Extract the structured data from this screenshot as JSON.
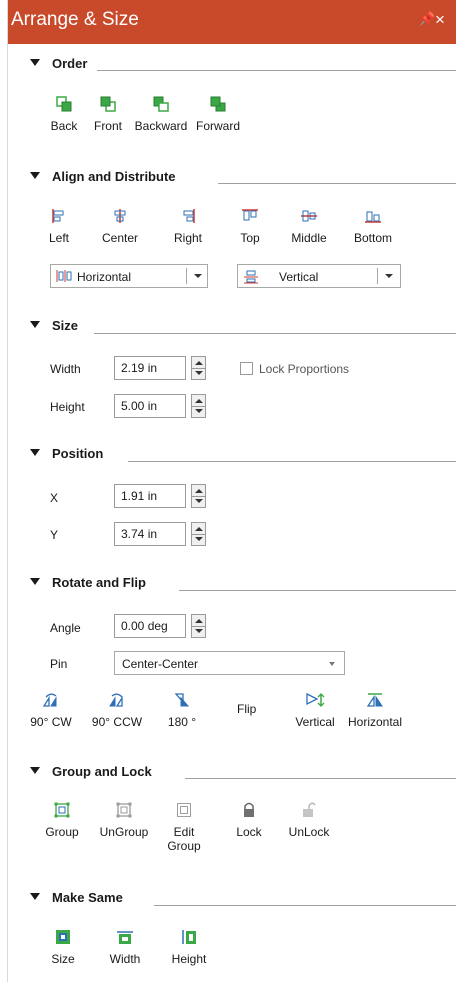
{
  "panel": {
    "title": "Arrange & Size",
    "pin_glyph": "\u0004",
    "close_glyph": "×",
    "accent": "#c94a2b",
    "green": "#3aa845",
    "blue": "#2f6fb6"
  },
  "order": {
    "header": "Order",
    "items": [
      {
        "label": "Back",
        "icon": "send-to-back-icon"
      },
      {
        "label": "Front",
        "icon": "bring-to-front-icon"
      },
      {
        "label": "Backward",
        "icon": "send-backward-icon"
      },
      {
        "label": "Forward",
        "icon": "bring-forward-icon"
      }
    ]
  },
  "align": {
    "header": "Align and Distribute",
    "items": [
      {
        "label": "Left",
        "icon": "align-left-icon"
      },
      {
        "label": "Center",
        "icon": "align-center-icon"
      },
      {
        "label": "Right",
        "icon": "align-right-icon"
      },
      {
        "label": "Top",
        "icon": "align-top-icon"
      },
      {
        "label": "Middle",
        "icon": "align-middle-icon"
      },
      {
        "label": "Bottom",
        "icon": "align-bottom-icon"
      }
    ],
    "distribute_horizontal": "Horizontal",
    "distribute_vertical": "Vertical"
  },
  "size": {
    "header": "Size",
    "width_label": "Width",
    "width_value": "2.19 in",
    "height_label": "Height",
    "height_value": "5.00 in",
    "lock_label": "Lock Proportions",
    "lock_checked": false
  },
  "position": {
    "header": "Position",
    "x_label": "X",
    "x_value": "1.91 in",
    "y_label": "Y",
    "y_value": "3.74 in"
  },
  "rotate": {
    "header": "Rotate and Flip",
    "angle_label": "Angle",
    "angle_value": "0.00 deg",
    "pin_label": "Pin",
    "pin_value": "Center-Center",
    "items": [
      {
        "label": "90° CW",
        "icon": "rotate-cw-icon"
      },
      {
        "label": "90° CCW",
        "icon": "rotate-ccw-icon"
      },
      {
        "label": "180 °",
        "icon": "rotate-180-icon"
      }
    ],
    "flip_label": "Flip",
    "flip_items": [
      {
        "label": "Vertical",
        "icon": "flip-vertical-icon"
      },
      {
        "label": "Horizontal",
        "icon": "flip-horizontal-icon"
      }
    ]
  },
  "group": {
    "header": "Group and Lock",
    "items": [
      {
        "label": "Group",
        "icon": "group-icon",
        "enabled": true
      },
      {
        "label": "UnGroup",
        "icon": "ungroup-icon",
        "enabled": true
      },
      {
        "label": "Edit Group",
        "label_line1": "Edit",
        "label_line2": "Group",
        "icon": "edit-group-icon",
        "enabled": true
      },
      {
        "label": "Lock",
        "icon": "lock-icon",
        "enabled": true
      },
      {
        "label": "UnLock",
        "icon": "unlock-icon",
        "enabled": true
      }
    ]
  },
  "make_same": {
    "header": "Make Same",
    "items": [
      {
        "label": "Size",
        "icon": "same-size-icon"
      },
      {
        "label": "Width",
        "icon": "same-width-icon"
      },
      {
        "label": "Height",
        "icon": "same-height-icon"
      }
    ]
  }
}
